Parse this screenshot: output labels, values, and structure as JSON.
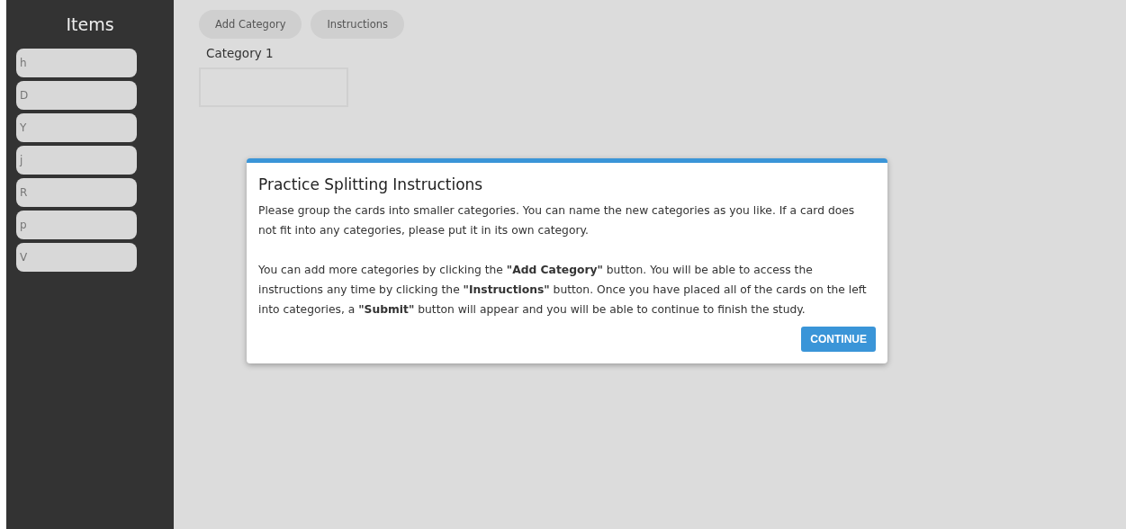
{
  "sidebar": {
    "title": "Items",
    "items": [
      "h",
      "D",
      "Y",
      "j",
      "R",
      "p",
      "V"
    ]
  },
  "toolbar": {
    "buttons": [
      "Add Category",
      "Instructions"
    ]
  },
  "categories": [
    {
      "name": "Category 1"
    }
  ],
  "dialog": {
    "title": "Practice Splitting Instructions",
    "paragraphs": [
      "Please group the cards into smaller categories. You can name the new categories as you like. If a card does not fit into any categories, please put it in its own category.",
      "You can add more categories by clicking the **\"Add Category\"** button. You will be able to access the instructions any time by clicking the **\"Instructions\"** button. Once you have placed all of the cards on the left into categories, a **\"Submit\"** button will appear and you will be able to continue to finish the study."
    ],
    "button": "CONTINUE"
  }
}
